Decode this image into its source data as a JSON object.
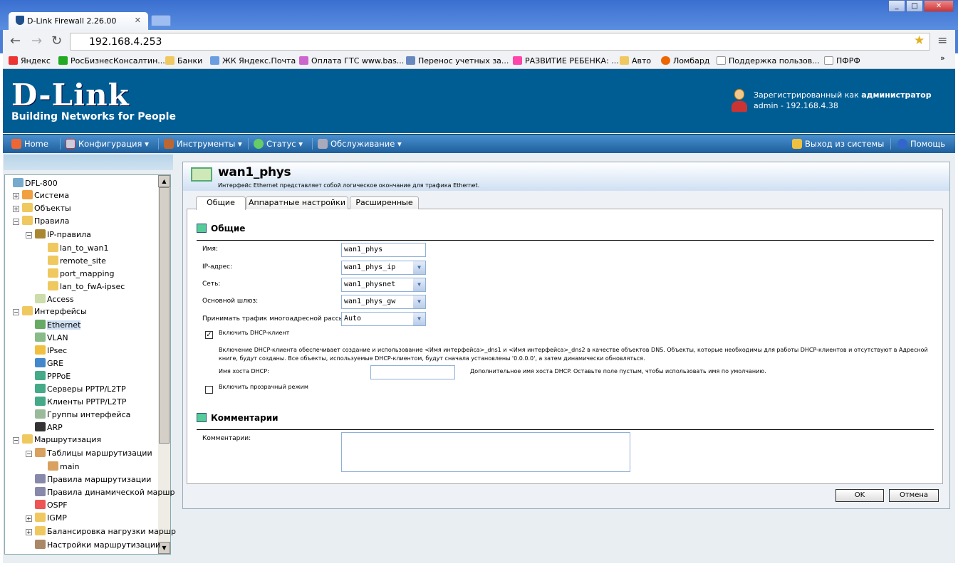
{
  "browser": {
    "tab_title": "D-Link Firewall 2.26.00",
    "url": "192.168.4.253",
    "bookmarks": [
      "Яндекс",
      "РосБизнесКонсалтин...",
      "Банки",
      "ЖК Яндекс.Почта",
      "Оплата ГТС www.bas...",
      "Перенос учетных за...",
      "РАЗВИТИЕ РЕБЕНКА: ...",
      "Авто",
      "Ломбард",
      "Поддержка пользов...",
      "ПФРФ"
    ],
    "more": "»"
  },
  "header": {
    "logo": "D-Link",
    "tagline": "Building Networks for People",
    "registered_as": "Зарегистрированный как",
    "role": "администратор",
    "session": "admin - 192.168.4.38"
  },
  "nav": {
    "home": "Home",
    "config": "Конфигурация",
    "tools": "Инструменты",
    "status": "Статус",
    "maintenance": "Обслуживание",
    "logout": "Выход из системы",
    "help": "Помощь"
  },
  "tree": [
    "DFL-800",
    "Система",
    "Объекты",
    "Правила",
    "IP-правила",
    "lan_to_wan1",
    "remote_site",
    "port_mapping",
    "lan_to_fwA-ipsec",
    "Access",
    "Интерфейсы",
    "Ethernet",
    "VLAN",
    "IPsec",
    "GRE",
    "PPPoE",
    "Серверы PPTP/L2TP",
    "Клиенты PPTP/L2TP",
    "Группы интерфейса",
    "ARP",
    "Маршрутизация",
    "Таблицы маршрутизации",
    "main",
    "Правила маршрутизации",
    "Правила динамической маршр",
    "OSPF",
    "IGMP",
    "Балансировка нагрузки маршр",
    "Настройки маршрутизации"
  ],
  "panel": {
    "title": "wan1_phys",
    "description": "Интерфейс Ethernet представляет собой логическое окончание для трафика Ethernet.",
    "tabs": [
      "Общие",
      "Аппаратные настройки",
      "Расширенные"
    ],
    "general": {
      "heading": "Общие",
      "name_label": "Имя:",
      "name_value": "wan1_phys",
      "ip_label": "IP-адрес:",
      "ip_value": "wan1_phys_ip",
      "net_label": "Сеть:",
      "net_value": "wan1_physnet",
      "gw_label": "Основной шлюз:",
      "gw_value": "wan1_phys_gw",
      "mcast_label": "Принимать трафик многоадресной рассылки:",
      "mcast_value": "Auto",
      "dhcp_label": "Включить DHCP-клиент",
      "dhcp_checked": true,
      "dhcp_desc": "Включение DHCP-клиента обеспечивает создание и использование <Имя интерфейса>_dns1 и <Имя интерфейса>_dns2 в качестве объектов DNS. Объекты, которые необходимы для работы DHCP-клиентов и отсутствуют в Адресной книге, будут созданы. Все объекты, используемые DHCP-клиентом, будут сначала установлены '0.0.0.0', а затем динамически обновляться.",
      "dhcp_host_label": "Имя хоста DHCP:",
      "dhcp_host_value": "",
      "dhcp_host_hint": "Дополнительное имя хоста DHCP. Оставьте поле пустым, чтобы использовать имя по умолчанию.",
      "transparent_label": "Включить прозрачный режим",
      "transparent_checked": false
    },
    "comments": {
      "heading": "Комментарии",
      "label": "Комментарии:",
      "value": ""
    },
    "ok": "OK",
    "cancel": "Отмена"
  }
}
